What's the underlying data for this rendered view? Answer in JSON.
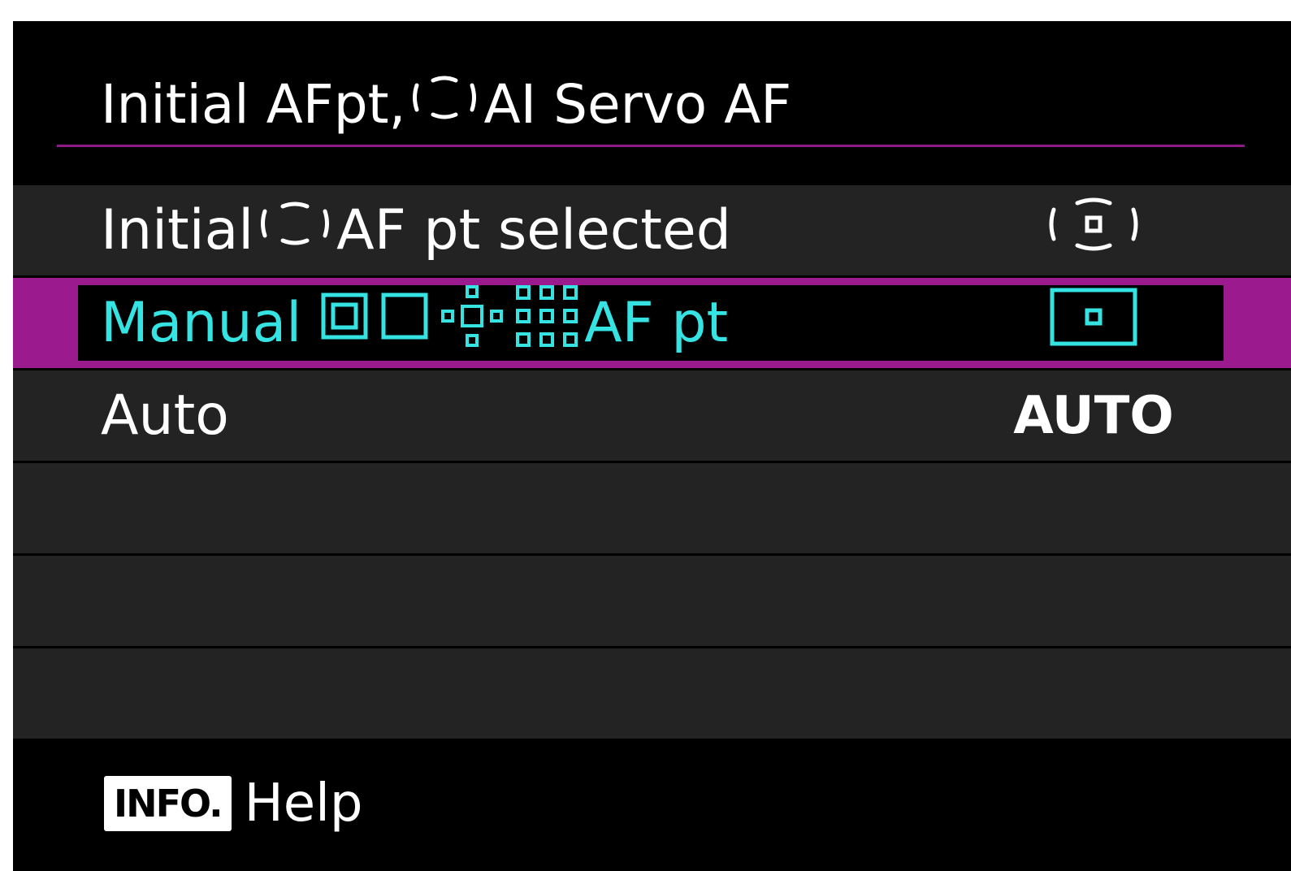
{
  "title": {
    "prefix": "Initial AFpt,",
    "suffix": "AI Servo AF",
    "frame_icon": "af-area-frame-icon"
  },
  "options": [
    {
      "label_prefix": "Initial",
      "label_suffix": "AF pt selected",
      "label_icon": "af-area-frame-icon",
      "value_icon": "af-area-frame-with-point-icon",
      "selected": false
    },
    {
      "label_prefix": "Manual",
      "label_suffix": "AF pt",
      "label_icons": [
        "spot-af-icon",
        "single-point-af-icon",
        "expand-af-cross-icon",
        "expand-af-surround-icon"
      ],
      "value_icon": "single-point-af-icon",
      "selected": true
    },
    {
      "label": "Auto",
      "value": "AUTO",
      "selected": false
    }
  ],
  "footer": {
    "badge": "INFO.",
    "label": "Help"
  },
  "colors": {
    "background": "#000000",
    "row": "#232323",
    "selection_border": "#9b1b8e",
    "title_rule": "#8e1a86",
    "selected_text": "#35e3e3",
    "text": "#ffffff"
  }
}
